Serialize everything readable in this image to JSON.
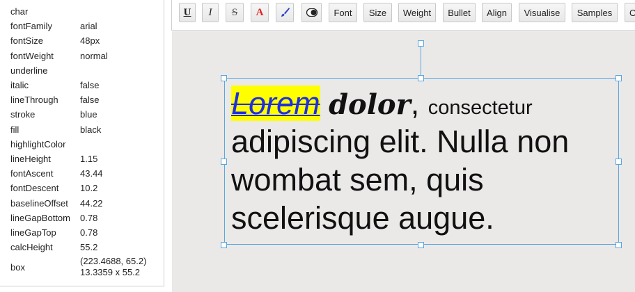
{
  "panel": {
    "rows": [
      {
        "key": "char",
        "value": ""
      },
      {
        "key": "fontFamily",
        "value": "arial"
      },
      {
        "key": "fontSize",
        "value": "48px"
      },
      {
        "key": "fontWeight",
        "value": "normal"
      },
      {
        "key": "underline",
        "value": ""
      },
      {
        "key": "italic",
        "value": "false"
      },
      {
        "key": "lineThrough",
        "value": "false"
      },
      {
        "key": "stroke",
        "value": "blue"
      },
      {
        "key": "fill",
        "value": "black"
      },
      {
        "key": "highlightColor",
        "value": ""
      },
      {
        "key": "lineHeight",
        "value": "1.15"
      },
      {
        "key": "fontAscent",
        "value": "43.44"
      },
      {
        "key": "fontDescent",
        "value": "10.2"
      },
      {
        "key": "baselineOffset",
        "value": "44.22"
      },
      {
        "key": "lineGapBottom",
        "value": "0.78"
      },
      {
        "key": "lineGapTop",
        "value": "0.78"
      },
      {
        "key": "calcHeight",
        "value": "55.2"
      },
      {
        "key": "box",
        "value": "(223.4688, 65.2)",
        "value2": "13.3359 x 55.2"
      }
    ]
  },
  "toolbar": {
    "underline_label": "U",
    "italic_label": "I",
    "strike_label": "S",
    "color_label": "A",
    "font_label": "Font",
    "size_label": "Size",
    "weight_label": "Weight",
    "bullet_label": "Bullet",
    "align_label": "Align",
    "visualise_label": "Visualise",
    "samples_label": "Samples",
    "overflow_label": "O"
  },
  "canvas": {
    "word_lorem": "Lorem",
    "word_dolor": "dolor",
    "word_comma": ",",
    "word_consectetur": "consectetur",
    "line2": "adipiscing elit. Nulla non",
    "line3": "wombat sem, quis",
    "line4": "scelerisque augue."
  },
  "colors": {
    "selection": "#57a7e0",
    "highlight": "#ffff00",
    "lorem_text": "#1e2ee0",
    "canvas_bg": "#ebe8e8"
  }
}
